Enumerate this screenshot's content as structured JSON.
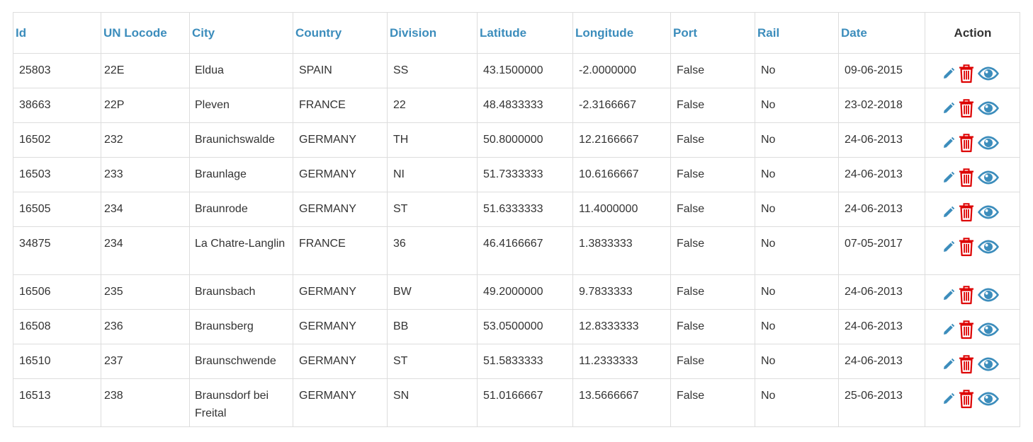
{
  "table": {
    "headers": {
      "id": "Id",
      "locode": "UN Locode",
      "city": "City",
      "country": "Country",
      "division": "Division",
      "latitude": "Latitude",
      "longitude": "Longitude",
      "port": "Port",
      "rail": "Rail",
      "date": "Date",
      "action": "Action"
    },
    "rows": [
      {
        "id": "25803",
        "locode": "22E",
        "city": "Eldua",
        "country": "SPAIN",
        "division": "SS",
        "latitude": "43.1500000",
        "longitude": "-2.0000000",
        "port": "False",
        "rail": "No",
        "date": "09-06-2015"
      },
      {
        "id": "38663",
        "locode": "22P",
        "city": "Pleven",
        "country": "FRANCE",
        "division": "22",
        "latitude": "48.4833333",
        "longitude": "-2.3166667",
        "port": "False",
        "rail": "No",
        "date": "23-02-2018"
      },
      {
        "id": "16502",
        "locode": "232",
        "city": "Braunichswalde",
        "country": "GERMANY",
        "division": "TH",
        "latitude": "50.8000000",
        "longitude": "12.2166667",
        "port": "False",
        "rail": "No",
        "date": "24-06-2013"
      },
      {
        "id": "16503",
        "locode": "233",
        "city": "Braunlage",
        "country": "GERMANY",
        "division": "NI",
        "latitude": "51.7333333",
        "longitude": "10.6166667",
        "port": "False",
        "rail": "No",
        "date": "24-06-2013"
      },
      {
        "id": "16505",
        "locode": "234",
        "city": "Braunrode",
        "country": "GERMANY",
        "division": "ST",
        "latitude": "51.6333333",
        "longitude": "11.4000000",
        "port": "False",
        "rail": "No",
        "date": "24-06-2013"
      },
      {
        "id": "34875",
        "locode": "234",
        "city": "La Chatre-Langlin",
        "country": "FRANCE",
        "division": "36",
        "latitude": "46.4166667",
        "longitude": "1.3833333",
        "port": "False",
        "rail": "No",
        "date": "07-05-2017"
      },
      {
        "id": "16506",
        "locode": "235",
        "city": "Braunsbach",
        "country": "GERMANY",
        "division": "BW",
        "latitude": "49.2000000",
        "longitude": "9.7833333",
        "port": "False",
        "rail": "No",
        "date": "24-06-2013"
      },
      {
        "id": "16508",
        "locode": "236",
        "city": "Braunsberg",
        "country": "GERMANY",
        "division": "BB",
        "latitude": "53.0500000",
        "longitude": "12.8333333",
        "port": "False",
        "rail": "No",
        "date": "24-06-2013"
      },
      {
        "id": "16510",
        "locode": "237",
        "city": "Braunschwende",
        "country": "GERMANY",
        "division": "ST",
        "latitude": "51.5833333",
        "longitude": "11.2333333",
        "port": "False",
        "rail": "No",
        "date": "24-06-2013"
      },
      {
        "id": "16513",
        "locode": "238",
        "city": "Braunsdorf bei Freital",
        "country": "GERMANY",
        "division": "SN",
        "latitude": "51.0166667",
        "longitude": "13.5666667",
        "port": "False",
        "rail": "No",
        "date": "25-06-2013"
      }
    ],
    "row_actions": [
      {
        "name": "edit",
        "icon": "pencil-icon",
        "color": "#3c8dbc"
      },
      {
        "name": "delete",
        "icon": "trash-icon",
        "color": "#dd0000"
      },
      {
        "name": "view",
        "icon": "eye-icon",
        "color": "#3c8dbc"
      }
    ]
  },
  "colors": {
    "header_link": "#3c8dbc",
    "body_text": "#333333",
    "border": "#dddddd",
    "danger": "#dd0000"
  }
}
